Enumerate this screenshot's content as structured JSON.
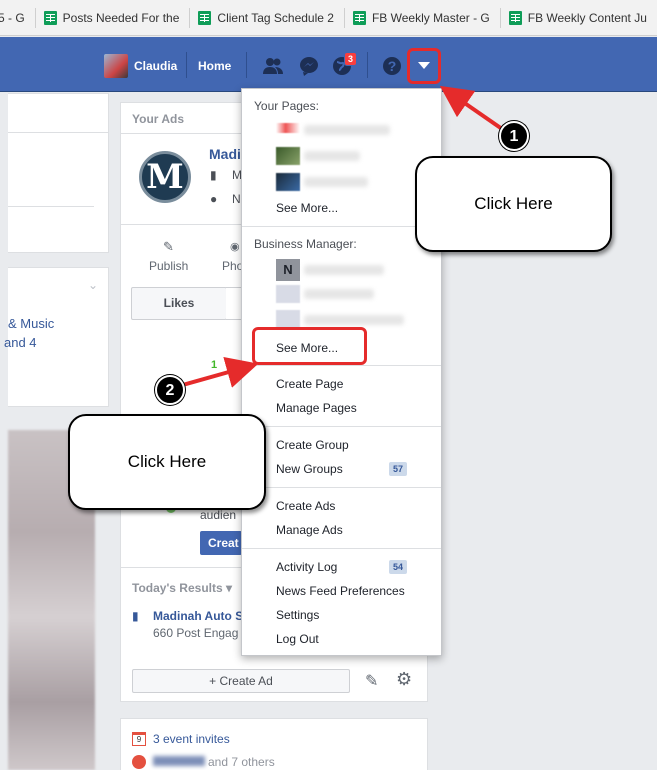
{
  "bookmarks": [
    {
      "label": "5 - G",
      "icon": "sheets-icon"
    },
    {
      "label": "Posts Needed For the",
      "icon": "sheets-icon"
    },
    {
      "label": "Client Tag Schedule 2",
      "icon": "sheets-icon"
    },
    {
      "label": "FB Weekly Master - G",
      "icon": "sheets-icon"
    },
    {
      "label": "FB Weekly Content Ju",
      "icon": "sheets-icon"
    }
  ],
  "header": {
    "user_name": "Claudia",
    "home_label": "Home",
    "notification_count": "3",
    "help_glyph": "?",
    "icons": [
      "friends-icon",
      "messenger-icon",
      "globe-icon",
      "help-icon",
      "caret-down-icon"
    ]
  },
  "left": {
    "music_line1": "& Music",
    "music_line2": "and 4"
  },
  "ads_panel": {
    "title": "Your Ads",
    "page_name": "Madi",
    "meta1": "M",
    "meta2": "N",
    "publish_label": "Publish",
    "photo_label": "Pho",
    "likes_tab": "Likes",
    "green_value": "1",
    "audience_text": "audien",
    "create_btn": "Creat",
    "results_title": "Today's Results",
    "result_page": "Madinah Auto S",
    "result_sub": "660 Post Engag",
    "create_ad_label": "+ Create Ad",
    "events_label": "3 event invites",
    "bottom_text": "and 7 others"
  },
  "dropdown": {
    "your_pages_title": "Your Pages:",
    "pages_see_more": "See More...",
    "business_title": "Business Manager:",
    "business_initial": "N",
    "business_see_more": "See More...",
    "items_group1": [
      "Create Page",
      "Manage Pages"
    ],
    "items_group2": [
      "Create Group",
      "New Groups"
    ],
    "new_groups_count": "57",
    "items_group3": [
      "Create Ads",
      "Manage Ads"
    ],
    "items_group4": [
      "Activity Log",
      "News Feed Preferences",
      "Settings",
      "Log Out"
    ],
    "activity_count": "54"
  },
  "callouts": {
    "step1_number": "1",
    "step1_text": "Click Here",
    "step2_number": "2",
    "step2_text": "Click Here"
  },
  "colors": {
    "fb_blue": "#4267b2",
    "annotation_red": "#e52b2b",
    "link_blue": "#365899"
  }
}
